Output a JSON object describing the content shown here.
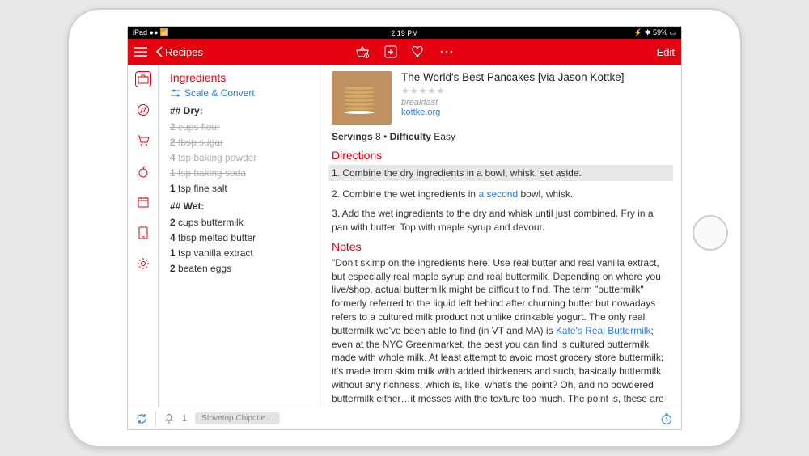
{
  "status": {
    "carrier": "iPad",
    "time": "2:19 PM",
    "battery": "59%"
  },
  "toolbar": {
    "back": "Recipes",
    "edit": "Edit"
  },
  "ingredients": {
    "title": "Ingredients",
    "scale": "Scale & Convert",
    "dry_head": "## Dry:",
    "dry": [
      {
        "qty": "2",
        "unit": "cups",
        "item": "flour",
        "done": true
      },
      {
        "qty": "2",
        "unit": "tbsp",
        "item": "sugar",
        "done": true
      },
      {
        "qty": "4",
        "unit": "tsp",
        "item": "baking powder",
        "done": true
      },
      {
        "qty": "1",
        "unit": "tsp",
        "item": "baking soda",
        "done": true
      },
      {
        "qty": "1",
        "unit": "tsp",
        "item": "fine salt",
        "done": false
      }
    ],
    "wet_head": "## Wet:",
    "wet": [
      {
        "qty": "2",
        "unit": "cups",
        "item": "buttermilk"
      },
      {
        "qty": "4",
        "unit": "tbsp",
        "item": "melted butter"
      },
      {
        "qty": "1",
        "unit": "tsp",
        "item": "vanilla extract"
      },
      {
        "qty": "2",
        "unit": "",
        "item": "beaten eggs"
      }
    ]
  },
  "recipe": {
    "title": "The World's Best Pancakes [via Jason Kottke]",
    "stars": "★★★★★",
    "category": "breakfast",
    "source": "kottke.org",
    "servings_label": "Servings",
    "servings": "8",
    "difficulty_label": "Difficulty",
    "difficulty": "Easy"
  },
  "directions": {
    "title": "Directions",
    "steps": [
      "1. Combine the dry ingredients in a bowl, whisk, set aside.",
      "2. Combine the wet ingredients in a second bowl, whisk.",
      "3. Add the wet ingredients to the dry and whisk until just combined. Fry in a pan with butter. Top with maple syrup and devour."
    ],
    "step2_prefix": "2. Combine the wet ingredients in ",
    "step2_link": "a second",
    "step2_suffix": " bowl, whisk."
  },
  "notes": {
    "title": "Notes",
    "text_prefix": "\"Don't skimp on the ingredients here. Use real butter and real vanilla extract, but especially real maple syrup and real buttermilk. Depending on where you live/shop, actual buttermilk might be difficult to find. The term \"buttermilk\" formerly referred to the liquid left behind after churning butter but nowadays refers to a cultured milk product not unlike drinkable yogurt. The only real buttermilk we've been able to find (in VT and MA) is ",
    "link": "Kate's Real Buttermilk",
    "text_suffix": "; even at the NYC Greenmarket, the best you can find is cultured buttermilk made with whole milk. At least attempt to avoid most grocery store buttermilk; it's made from skim milk with added thickeners and such, basically buttermilk without any richness, which is, like, what's the point? Oh, and no powdered buttermilk either…it messes with the texture too much. The point is, these are buttermilk pancakes and they taste best with the best"
  },
  "bottom": {
    "pin_count": "1",
    "chip": "Stovetop Chipotle…"
  }
}
